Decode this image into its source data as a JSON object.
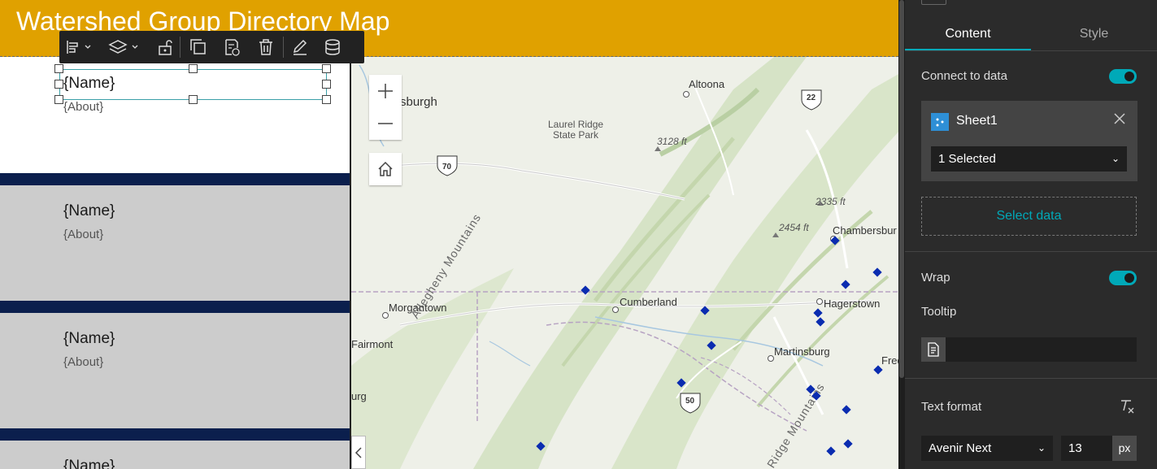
{
  "page": {
    "title": "Watershed Group Directory Map"
  },
  "list": {
    "items": [
      {
        "name": "{Name}",
        "about": "{About}"
      },
      {
        "name": "{Name}",
        "about": "{About}"
      },
      {
        "name": "{Name}",
        "about": "{About}"
      },
      {
        "name": "{Name}",
        "about": ""
      }
    ]
  },
  "toolbar": {
    "icons": [
      "align-icon",
      "layers-icon",
      "unlock-icon",
      "duplicate-icon",
      "edit-template-icon",
      "delete-icon",
      "pen-icon",
      "database-icon"
    ]
  },
  "map": {
    "labels": {
      "altoona": "Altoona",
      "burgh": "sburgh",
      "laurel_ridge": "Laurel Ridge",
      "state_park": "State Park",
      "elev_3128": "3128 ft",
      "elev_2335": "2335 ft",
      "elev_2454": "2454 ft",
      "chambersburg": "Chambersbur",
      "morgantown": "Morgantown",
      "cumberland": "Cumberland",
      "hagerstown": "Hagerstown",
      "fairmont": "Fairmont",
      "martinsburg": "Martinsburg",
      "fred": "Fred",
      "urg": "urg",
      "allegheny": "Allegheny Mountains",
      "ridge_mountains": "Ridge Mountains",
      "route_70": "70",
      "route_22": "22",
      "route_50": "50"
    },
    "marker_color": "#0a2cb0"
  },
  "panel": {
    "tabs": {
      "content": "Content",
      "style": "Style"
    },
    "connect_label": "Connect to data",
    "datasource_name": "Sheet1",
    "selection": "1 Selected",
    "select_data": "Select data",
    "wrap_label": "Wrap",
    "tooltip_label": "Tooltip",
    "text_format_label": "Text format",
    "font": "Avenir Next",
    "font_size": "13",
    "unit": "px",
    "accent": "#00a9b8"
  }
}
